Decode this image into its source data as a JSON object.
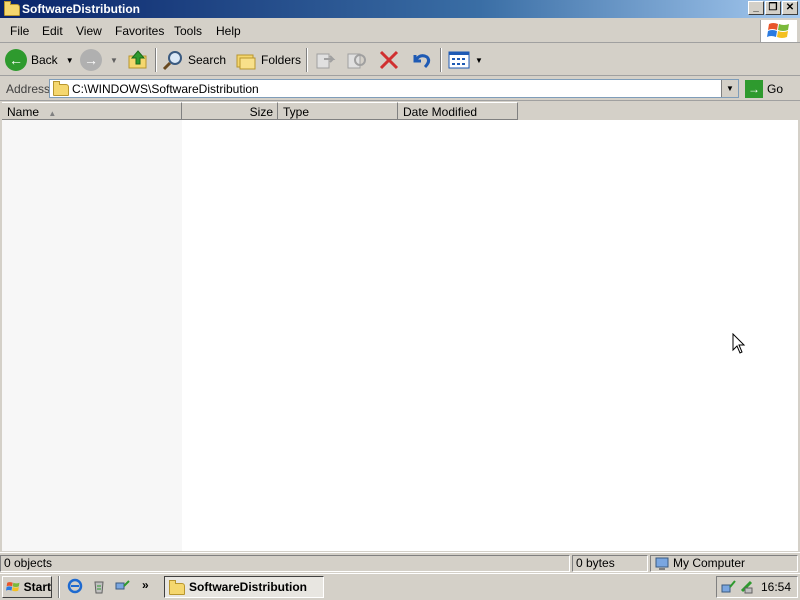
{
  "window": {
    "title": "SoftwareDistribution"
  },
  "menu": {
    "items": [
      "File",
      "Edit",
      "View",
      "Favorites",
      "Tools",
      "Help"
    ]
  },
  "toolbar": {
    "back_label": "Back",
    "search_label": "Search",
    "folders_label": "Folders"
  },
  "address": {
    "label": "Address",
    "value": "C:\\WINDOWS\\SoftwareDistribution",
    "go_label": "Go"
  },
  "list": {
    "columns": [
      "Name",
      "Size",
      "Type",
      "Date Modified"
    ],
    "rows": []
  },
  "status": {
    "objects": "0 objects",
    "bytes": "0 bytes",
    "location": "My Computer"
  },
  "taskbar": {
    "start_label": "Start",
    "task_label": "SoftwareDistribution",
    "chevron": "»",
    "clock": "16:54"
  },
  "colors": {
    "titlebar": "#0a246a",
    "back_arrow": "#2e9a2e",
    "forward_arrow": "#b0b0b0",
    "delete_x": "#d03030",
    "undo": "#1e5ab4"
  }
}
